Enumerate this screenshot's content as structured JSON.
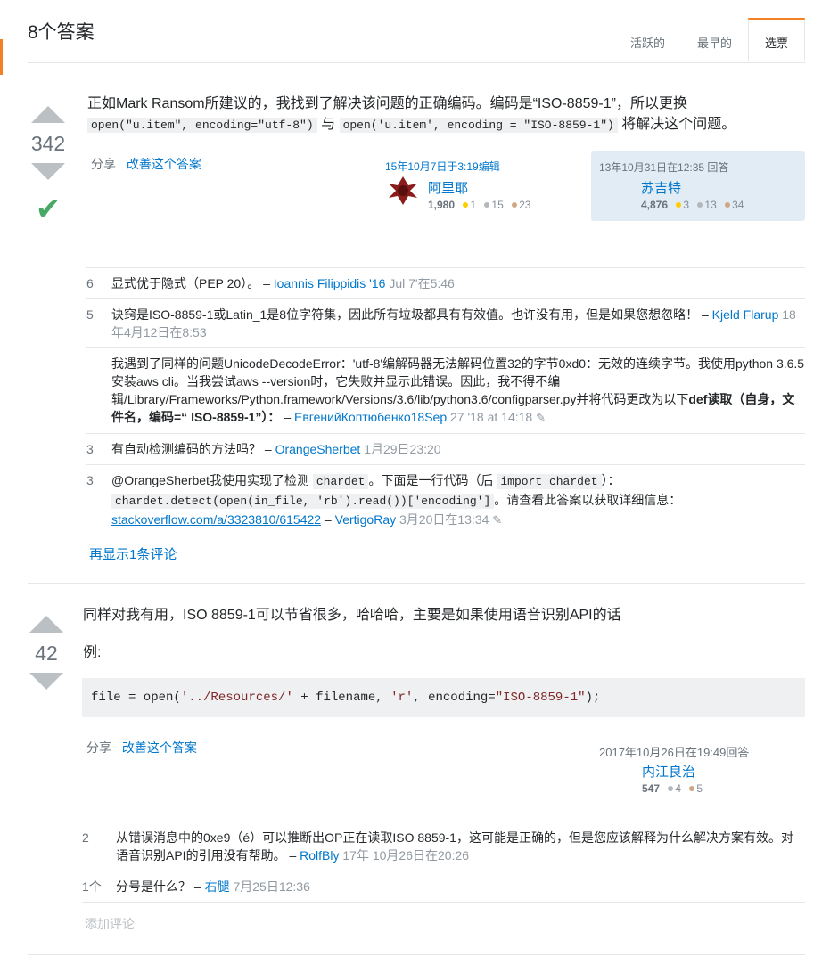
{
  "header": {
    "title": "8个答案",
    "tabs": [
      "活跃的",
      "最早的",
      "选票"
    ]
  },
  "answer1": {
    "score": "342",
    "text1": "正如Mark Ransom所建议的，我找到了解决该问题的正确编码。编码是“ISO-8859-1”，所以更换",
    "code1": "open(\"u.item\", encoding=\"utf-8\")",
    "text2": "与",
    "code2": "open('u.item', encoding = \"ISO-8859-1\")",
    "text3": "将解决这个问题。",
    "share": "分享",
    "improve": "改善这个答案",
    "edited": {
      "time": "15年10月7日于3:19编辑",
      "user": "阿里耶",
      "rep": "1,980",
      "gold": "1",
      "silver": "15",
      "bronze": "23"
    },
    "answered": {
      "time": "13年10月31日在12:35 回答",
      "user": "苏吉特",
      "rep": "4,876",
      "gold": "3",
      "silver": "13",
      "bronze": "34"
    },
    "comments": {
      "c1": {
        "votes": "6",
        "text": "显式优于隐式（PEP 20）。 –",
        "user": "Ioannis Filippidis '16",
        "date": "Jul 7'在5:46"
      },
      "c2": {
        "votes": "5",
        "text": "诀窍是ISO-8859-1或Latin_1是8位字符集，因此所有垃圾都具有有效值。也许没有用，但是如果您想忽略！ –",
        "user": "Kjeld Flarup",
        "date": "18年4月12日在8:53"
      },
      "c3": {
        "votes": "",
        "text": "我遇到了同样的问题UnicodeDecodeError：'utf-8'编解码器无法解码位置32的字节0xd0：无效的连续字节。我使用python 3.6.5安装aws cli。当我尝试aws --version时，它失败并显示此错误。因此，我不得不编辑/Library/Frameworks/Python.framework/Versions/3.6/lib/python3.6/configparser.py并将代码更改为以下",
        "bold": "def读取（自身，文件名，编码=“ ISO-8859-1”）：",
        "dash": " – ",
        "user": "ЕвгенийКоптюбенко18Sep",
        "date": "27 '18 at 14:18"
      },
      "c4": {
        "votes": "3",
        "text": "有自动检测编码的方法吗？ –",
        "user": "OrangeSherbet",
        "date": "1月29日23:20"
      },
      "c5": {
        "votes": "3",
        "text1": "@OrangeSherbet我使用实现了检测",
        "code1": "chardet",
        "text2": "。下面是一行代码（后",
        "code2": "import chardet",
        "text3": "）：",
        "code3": "chardet.detect(open(in_file, 'rb').read())['encoding']",
        "text4": "。请查看此答案以获取详细信息：",
        "link": "stackoverflow.com/a/3323810/615422",
        "dash": " – ",
        "user": "VertigoRay",
        "date": "3月20日在13:34"
      }
    },
    "more_comments": "再显示1条评论"
  },
  "answer2": {
    "score": "42",
    "text1": "同样对我有用，ISO 8859-1可以节省很多，哈哈哈，主要是如果使用语音识别API的话",
    "text2": "例:",
    "code": {
      "p1": "file = open(",
      "s1": "'../Resources/'",
      "p2": " + filename, ",
      "s2": "'r'",
      "p3": ", encoding=",
      "s3": "\"ISO-8859-1\"",
      "p4": ");"
    },
    "share": "分享",
    "improve": "改善这个答案",
    "answered": {
      "time": "2017年10月26日在19:49回答",
      "user": "内江良治",
      "rep": "547",
      "silver": "4",
      "bronze": "5"
    },
    "comments": {
      "c1": {
        "votes": "2",
        "text": "从错误消息中的0xe9（é）可以推断出OP正在读取ISO 8859-1，这可能是正确的，但是您应该解释为什么解决方案有效。对语音识别API的引用没有帮助。 –",
        "user": "RolfBly",
        "date": "17年 10月26日在20:26"
      },
      "c2": {
        "votes": "1个",
        "text": "分号是什么？ –",
        "user": "右腿",
        "date": "7月25日12:36"
      }
    },
    "add_comment": "添加评论"
  }
}
